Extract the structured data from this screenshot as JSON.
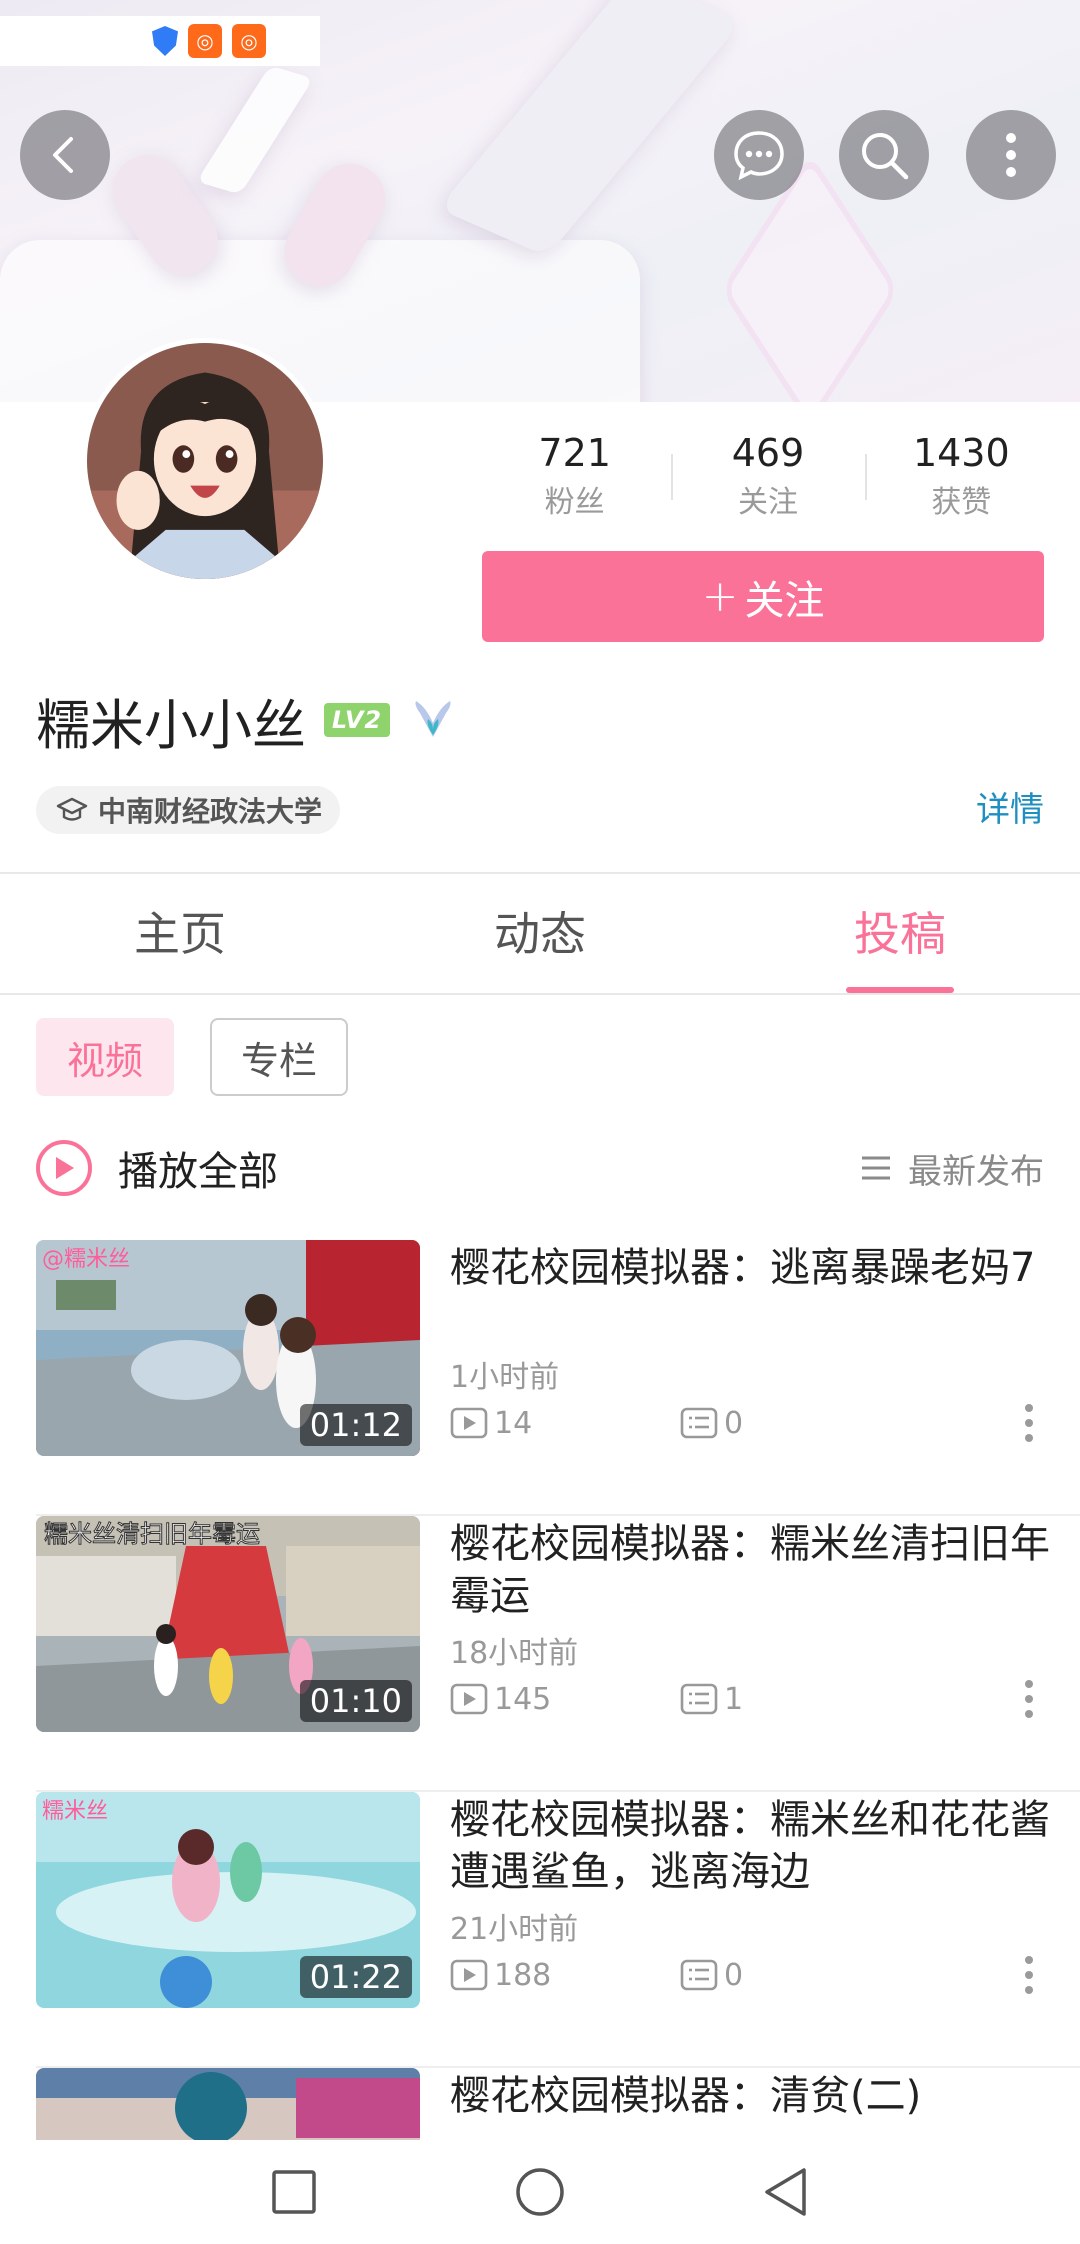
{
  "profile": {
    "name": "糯米小小丝",
    "level": "LV2",
    "school": "中南财经政法大学",
    "details_link": "详情"
  },
  "stats": [
    {
      "value": "721",
      "label": "粉丝"
    },
    {
      "value": "469",
      "label": "关注"
    },
    {
      "value": "1430",
      "label": "获赞"
    }
  ],
  "follow_button": {
    "label": "关注",
    "plus": "+"
  },
  "tabs": [
    {
      "label": "主页",
      "active": false
    },
    {
      "label": "动态",
      "active": false
    },
    {
      "label": "投稿",
      "active": true
    }
  ],
  "filters": [
    {
      "label": "视频",
      "active": true
    },
    {
      "label": "专栏",
      "active": false
    }
  ],
  "play_all": {
    "label": "播放全部",
    "sort_label": "最新发布"
  },
  "videos": [
    {
      "title": "樱花校园模拟器：逃离暴躁老妈7",
      "duration": "01:12",
      "time": "1小时前",
      "plays": "14",
      "comments": "0"
    },
    {
      "title": "樱花校园模拟器：糯米丝清扫旧年霉运",
      "duration": "01:10",
      "time": "18小时前",
      "plays": "145",
      "comments": "1"
    },
    {
      "title": "樱花校园模拟器：糯米丝和花花酱遭遇鲨鱼，逃离海边",
      "duration": "01:22",
      "time": "21小时前",
      "plays": "188",
      "comments": "0"
    },
    {
      "title": "樱花校园模拟器：清贫(二)",
      "duration": "",
      "time": "",
      "plays": "",
      "comments": ""
    }
  ],
  "status_icons": [
    "shield-icon",
    "app-notification-icon",
    "app-notification-icon"
  ],
  "header_icons": [
    "back-icon",
    "message-icon",
    "search-icon",
    "more-icon"
  ],
  "navbar_icons": [
    "recent-apps-icon",
    "home-icon",
    "back-triangle-icon"
  ],
  "colors": {
    "accent": "#fb7299",
    "link": "#1f8fbf",
    "level_badge": "#8fd36c"
  }
}
